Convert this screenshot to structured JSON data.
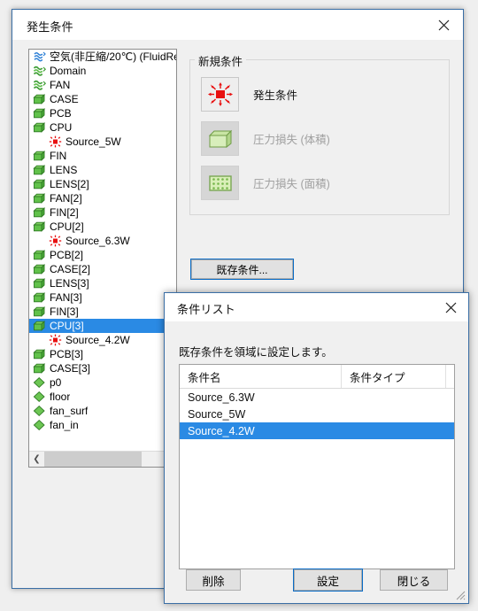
{
  "main_dialog": {
    "title": "発生条件",
    "close_icon": "close-icon",
    "tree": {
      "items": [
        {
          "label": "空気(非圧縮/20℃) (FluidRe",
          "icon": "fluid-icon",
          "indent": 0,
          "selected": false
        },
        {
          "label": "Domain",
          "icon": "fluid-icon-green",
          "indent": 0,
          "selected": false
        },
        {
          "label": "FAN",
          "icon": "fluid-icon-green",
          "indent": 0,
          "selected": false
        },
        {
          "label": "CASE",
          "icon": "solid-box-icon",
          "indent": 0,
          "selected": false
        },
        {
          "label": "PCB",
          "icon": "solid-box-icon",
          "indent": 0,
          "selected": false
        },
        {
          "label": "CPU",
          "icon": "solid-box-icon",
          "indent": 0,
          "selected": false
        },
        {
          "label": "Source_5W",
          "icon": "heat-source-icon",
          "indent": 1,
          "selected": false
        },
        {
          "label": "FIN",
          "icon": "solid-box-icon",
          "indent": 0,
          "selected": false
        },
        {
          "label": "LENS",
          "icon": "solid-box-icon",
          "indent": 0,
          "selected": false
        },
        {
          "label": "LENS[2]",
          "icon": "solid-box-icon",
          "indent": 0,
          "selected": false
        },
        {
          "label": "FAN[2]",
          "icon": "solid-box-icon",
          "indent": 0,
          "selected": false
        },
        {
          "label": "FIN[2]",
          "icon": "solid-box-icon",
          "indent": 0,
          "selected": false
        },
        {
          "label": "CPU[2]",
          "icon": "solid-box-icon",
          "indent": 0,
          "selected": false
        },
        {
          "label": "Source_6.3W",
          "icon": "heat-source-icon",
          "indent": 1,
          "selected": false
        },
        {
          "label": "PCB[2]",
          "icon": "solid-box-icon",
          "indent": 0,
          "selected": false
        },
        {
          "label": "CASE[2]",
          "icon": "solid-box-icon",
          "indent": 0,
          "selected": false
        },
        {
          "label": "LENS[3]",
          "icon": "solid-box-icon",
          "indent": 0,
          "selected": false
        },
        {
          "label": "FAN[3]",
          "icon": "solid-box-icon",
          "indent": 0,
          "selected": false
        },
        {
          "label": "FIN[3]",
          "icon": "solid-box-icon",
          "indent": 0,
          "selected": false
        },
        {
          "label": "CPU[3]",
          "icon": "solid-box-icon",
          "indent": 0,
          "selected": true
        },
        {
          "label": "Source_4.2W",
          "icon": "heat-source-icon",
          "indent": 1,
          "selected": false
        },
        {
          "label": "PCB[3]",
          "icon": "solid-box-icon",
          "indent": 0,
          "selected": false
        },
        {
          "label": "CASE[3]",
          "icon": "solid-box-icon",
          "indent": 0,
          "selected": false
        },
        {
          "label": "p0",
          "icon": "face-diamond-icon",
          "indent": 0,
          "selected": false
        },
        {
          "label": "floor",
          "icon": "face-diamond-icon",
          "indent": 0,
          "selected": false
        },
        {
          "label": "fan_surf",
          "icon": "face-diamond-icon",
          "indent": 0,
          "selected": false
        },
        {
          "label": "fan_in",
          "icon": "face-diamond-icon",
          "indent": 0,
          "selected": false
        }
      ],
      "scroll_left_icon": "chevron-left-icon",
      "scroll_right_icon": "chevron-right-icon"
    },
    "group_new": {
      "title": "新規条件",
      "options": [
        {
          "label": "発生条件",
          "icon": "heat-generation-icon",
          "enabled": true
        },
        {
          "label": "圧力損失 (体積)",
          "icon": "pressure-loss-volume-icon",
          "enabled": false
        },
        {
          "label": "圧力損失 (面積)",
          "icon": "pressure-loss-area-icon",
          "enabled": false
        }
      ]
    },
    "existing_button": "既存条件..."
  },
  "list_dialog": {
    "title": "条件リスト",
    "close_icon": "close-icon",
    "description": "既存条件を領域に設定します。",
    "table": {
      "columns": [
        "条件名",
        "条件タイプ"
      ],
      "rows": [
        {
          "name": "Source_6.3W",
          "type": "",
          "selected": false
        },
        {
          "name": "Source_5W",
          "type": "",
          "selected": false
        },
        {
          "name": "Source_4.2W",
          "type": "",
          "selected": true
        }
      ]
    },
    "buttons": {
      "delete": "削除",
      "set": "設定",
      "close": "閉じる"
    },
    "resize_grip_icon": "resize-grip-icon"
  },
  "colors": {
    "selection_blue": "#2a8ae4",
    "focus_blue": "#0a6cc6",
    "dialog_border": "#3a6ea5",
    "heat_red": "#e81111",
    "solid_green": "#5fbf4a"
  }
}
